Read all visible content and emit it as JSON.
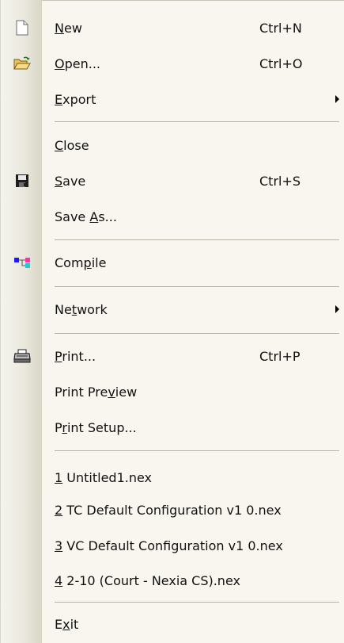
{
  "menu": {
    "items": [
      {
        "id": "new",
        "pre": "",
        "u": "N",
        "post": "ew",
        "shortcut": "Ctrl+N",
        "icon": "new-document-icon"
      },
      {
        "id": "open",
        "pre": "",
        "u": "O",
        "post": "pen...",
        "shortcut": "Ctrl+O",
        "icon": "open-folder-icon"
      },
      {
        "id": "export",
        "pre": "",
        "u": "E",
        "post": "xport",
        "submenu": true
      },
      {
        "id": "close",
        "pre": "",
        "u": "C",
        "post": "lose"
      },
      {
        "id": "save",
        "pre": "",
        "u": "S",
        "post": "ave",
        "shortcut": "Ctrl+S",
        "icon": "floppy-disk-icon"
      },
      {
        "id": "save-as",
        "pre": "Save ",
        "u": "A",
        "post": "s..."
      },
      {
        "id": "compile",
        "pre": "Com",
        "u": "p",
        "post": "ile",
        "icon": "compile-icon"
      },
      {
        "id": "network",
        "pre": "Ne",
        "u": "t",
        "post": "work",
        "submenu": true
      },
      {
        "id": "print",
        "pre": "",
        "u": "P",
        "post": "rint...",
        "shortcut": "Ctrl+P",
        "icon": "printer-icon"
      },
      {
        "id": "print-preview",
        "pre": "Print Pre",
        "u": "v",
        "post": "iew"
      },
      {
        "id": "print-setup",
        "pre": "P",
        "u": "r",
        "post": "int Setup..."
      },
      {
        "id": "recent-1",
        "pre": "",
        "u": "1",
        "post": " Untitled1.nex"
      },
      {
        "id": "recent-2",
        "pre": "",
        "u": "2",
        "post": " TC Default Configuration v1 0.nex"
      },
      {
        "id": "recent-3",
        "pre": "",
        "u": "3",
        "post": " VC Default Configuration v1 0.nex"
      },
      {
        "id": "recent-4",
        "pre": "",
        "u": "4",
        "post": " 2-10 (Court - Nexia CS).nex"
      },
      {
        "id": "exit",
        "pre": "E",
        "u": "x",
        "post": "it"
      }
    ]
  }
}
